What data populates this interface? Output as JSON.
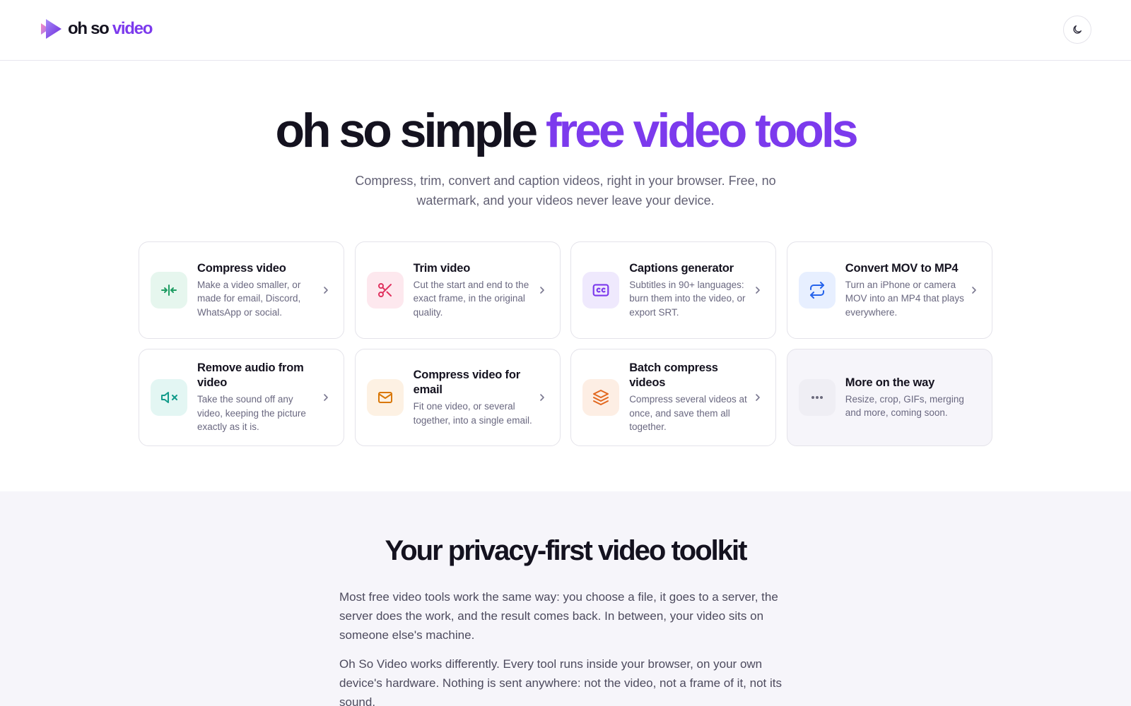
{
  "header": {
    "brand_oh": "oh so",
    "brand_video": "video",
    "theme_icon": "moon-icon"
  },
  "hero": {
    "title_dark": "oh so simple",
    "title_accent": "free video tools",
    "subtitle": "Compress, trim, convert and caption videos, right in your browser. Free, no watermark, and your videos never leave your device."
  },
  "tools": [
    {
      "title": "Compress video",
      "desc": "Make a video smaller, or made for email, Discord, WhatsApp or social.",
      "icon": "compress-icon",
      "icon_color": "#1f9d63",
      "icon_bg": "#e6f6ee"
    },
    {
      "title": "Trim video",
      "desc": "Cut the start and end to the exact frame, in the original quality.",
      "icon": "scissors-icon",
      "icon_color": "#e0325f",
      "icon_bg": "#fde8ee"
    },
    {
      "title": "Captions generator",
      "desc": "Subtitles in 90+ languages: burn them into the video, or export SRT.",
      "icon": "cc-icon",
      "icon_color": "#7c3aed",
      "icon_bg": "#efe9fd"
    },
    {
      "title": "Convert MOV to MP4",
      "desc": "Turn an iPhone or camera MOV into an MP4 that plays everywhere.",
      "icon": "convert-arrows-icon",
      "icon_color": "#2563eb",
      "icon_bg": "#e7efff"
    },
    {
      "title": "Remove audio from video",
      "desc": "Take the sound off any video, keeping the picture exactly as it is.",
      "icon": "mute-icon",
      "icon_color": "#129b8a",
      "icon_bg": "#e3f6f3"
    },
    {
      "title": "Compress video for email",
      "desc": "Fit one video, or several together, into a single email.",
      "icon": "mail-icon",
      "icon_color": "#d97706",
      "icon_bg": "#fdf1e3"
    },
    {
      "title": "Batch compress videos",
      "desc": "Compress several videos at once, and save them all together.",
      "icon": "layers-icon",
      "icon_color": "#e2671f",
      "icon_bg": "#fdeee4"
    },
    {
      "title": "More on the way",
      "desc": "Resize, crop, GIFs, merging and more, coming soon.",
      "icon": "more-dots-icon",
      "icon_color": "#6b6a7c",
      "icon_bg": "#efeef4"
    }
  ],
  "privacy": {
    "title": "Your privacy-first video toolkit",
    "p1": "Most free video tools work the same way: you choose a file, it goes to a server, the server does the work, and the result comes back. In between, your video sits on someone else's machine.",
    "p2": "Oh So Video works differently. Every tool runs inside your browser, on your own device's hardware. Nothing is sent anywhere: not the video, not a frame of it, not its sound."
  }
}
